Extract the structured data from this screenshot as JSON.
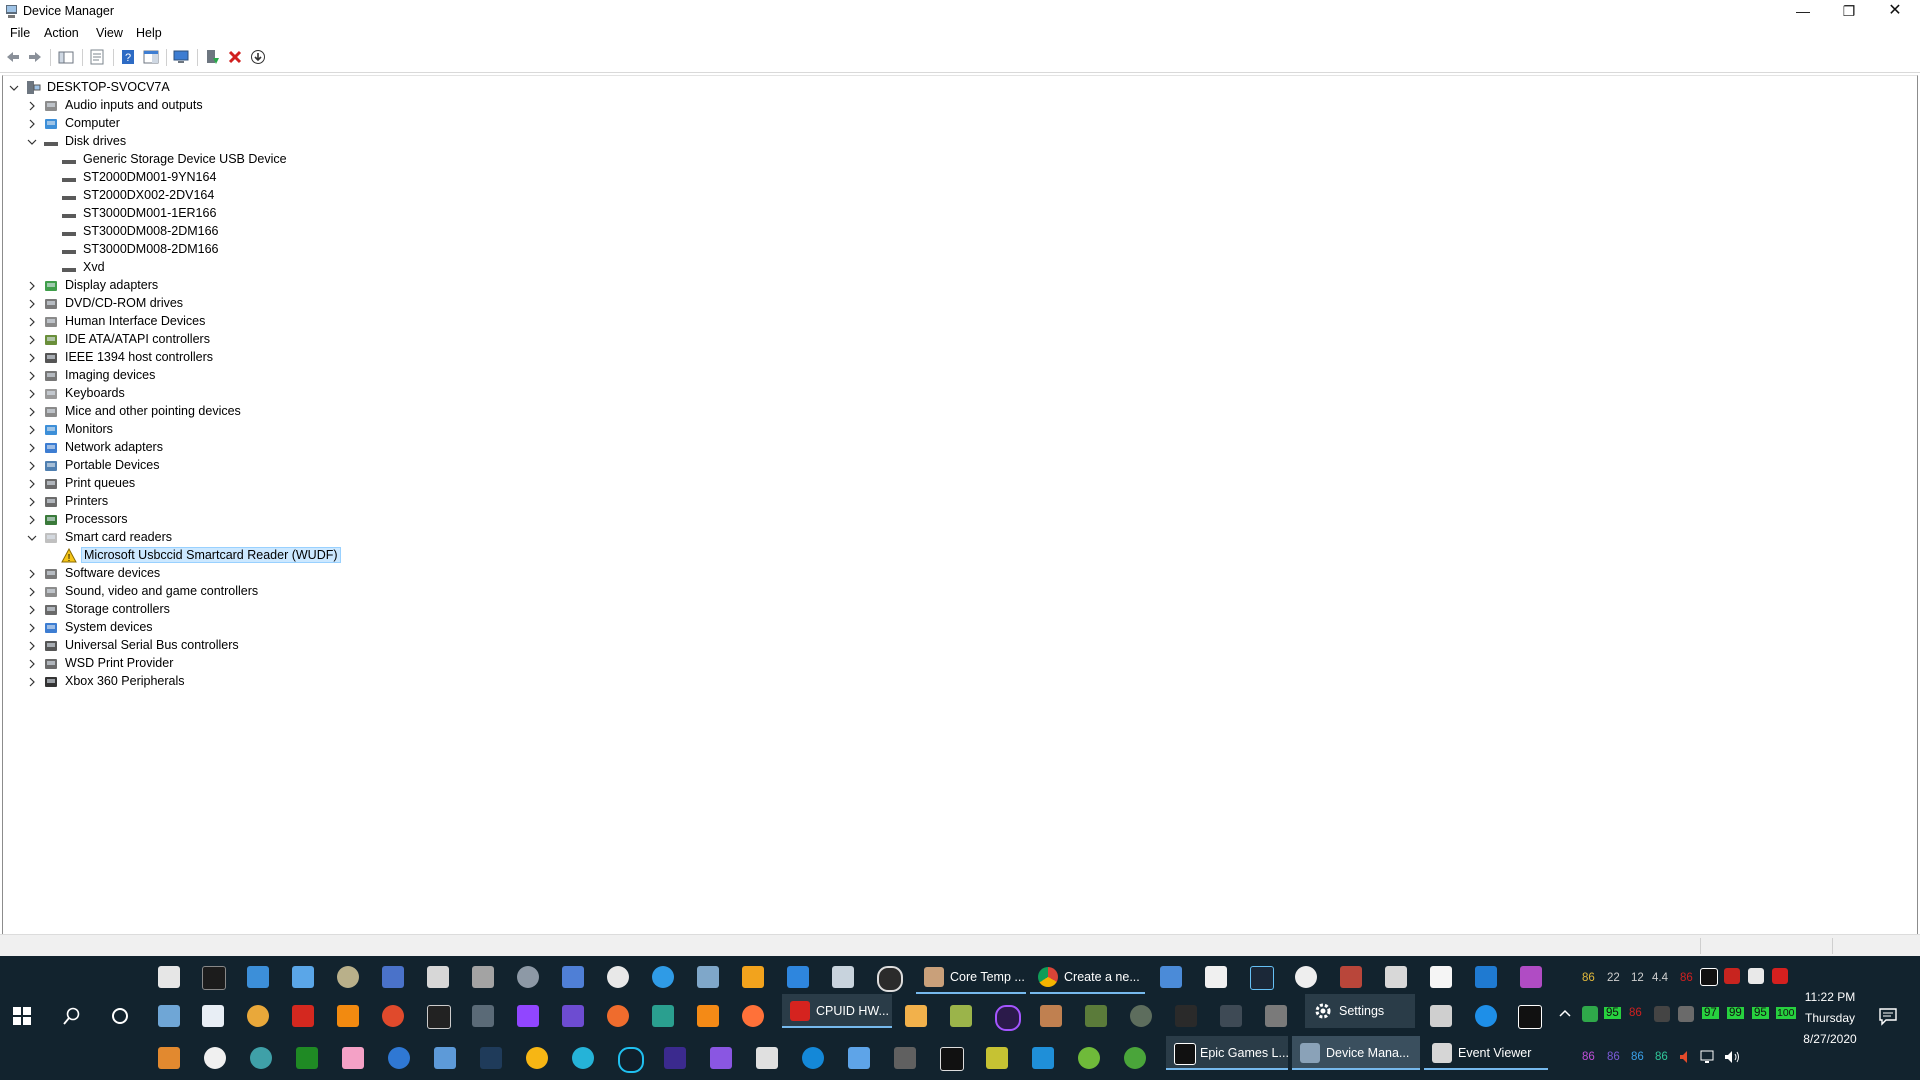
{
  "window": {
    "title": "Device Manager",
    "controls": {
      "minimize": "—",
      "restore": "❐",
      "close": "✕"
    }
  },
  "menu": [
    "File",
    "Action",
    "View",
    "Help"
  ],
  "tree": {
    "root": "DESKTOP-SVOCV7A",
    "rows": [
      {
        "label": "Audio inputs and outputs",
        "expanded": false,
        "icon": "speaker-icon"
      },
      {
        "label": "Computer",
        "expanded": false,
        "icon": "monitor-icon"
      },
      {
        "label": "Disk drives",
        "expanded": true,
        "icon": "disk-drive-icon",
        "children": [
          "Generic Storage Device USB Device",
          "ST2000DM001-9YN164",
          "ST2000DX002-2DV164",
          "ST3000DM001-1ER166",
          "ST3000DM008-2DM166",
          "ST3000DM008-2DM166",
          "Xvd"
        ]
      },
      {
        "label": "Display adapters",
        "expanded": false,
        "icon": "display-adapter-icon"
      },
      {
        "label": "DVD/CD-ROM drives",
        "expanded": false,
        "icon": "dvd-drive-icon"
      },
      {
        "label": "Human Interface Devices",
        "expanded": false,
        "icon": "hid-icon"
      },
      {
        "label": "IDE ATA/ATAPI controllers",
        "expanded": false,
        "icon": "ide-controller-icon"
      },
      {
        "label": "IEEE 1394 host controllers",
        "expanded": false,
        "icon": "firewire-icon"
      },
      {
        "label": "Imaging devices",
        "expanded": false,
        "icon": "camera-icon"
      },
      {
        "label": "Keyboards",
        "expanded": false,
        "icon": "keyboard-icon"
      },
      {
        "label": "Mice and other pointing devices",
        "expanded": false,
        "icon": "mouse-icon"
      },
      {
        "label": "Monitors",
        "expanded": false,
        "icon": "monitor-icon"
      },
      {
        "label": "Network adapters",
        "expanded": false,
        "icon": "network-adapter-icon"
      },
      {
        "label": "Portable Devices",
        "expanded": false,
        "icon": "portable-device-icon"
      },
      {
        "label": "Print queues",
        "expanded": false,
        "icon": "printer-icon"
      },
      {
        "label": "Printers",
        "expanded": false,
        "icon": "printer-icon"
      },
      {
        "label": "Processors",
        "expanded": false,
        "icon": "processor-icon"
      },
      {
        "label": "Smart card readers",
        "expanded": true,
        "icon": "smart-card-reader-icon",
        "children": [
          "Microsoft Usbccid Smartcard Reader (WUDF)"
        ]
      },
      {
        "label": "Software devices",
        "expanded": false,
        "icon": "software-device-icon"
      },
      {
        "label": "Sound, video and game controllers",
        "expanded": false,
        "icon": "speaker-icon"
      },
      {
        "label": "Storage controllers",
        "expanded": false,
        "icon": "storage-controller-icon"
      },
      {
        "label": "System devices",
        "expanded": false,
        "icon": "system-device-icon"
      },
      {
        "label": "Universal Serial Bus controllers",
        "expanded": false,
        "icon": "usb-icon"
      },
      {
        "label": "WSD Print Provider",
        "expanded": false,
        "icon": "printer-icon"
      },
      {
        "label": "Xbox 360 Peripherals",
        "expanded": false,
        "icon": "gamepad-icon"
      }
    ],
    "selected": "Microsoft Usbccid Smartcard Reader (WUDF)"
  },
  "taskbar": {
    "buttons": {
      "core_temp": "Core Temp ...",
      "create_new": "Create a ne...",
      "cpuid": "CPUID HW...",
      "settings": "Settings",
      "epic": "Epic Games L...",
      "device_manager": "Device Mana...",
      "event_viewer": "Event Viewer"
    },
    "tray_row1": [
      "86",
      "22",
      "12",
      "4.4"
    ],
    "tray_row1_extra": "86",
    "tray_row2": [
      "95",
      "86",
      "97",
      "99",
      "95",
      "100"
    ],
    "tray_row3": [
      "86",
      "86",
      "86",
      "86"
    ],
    "clock": {
      "time": "11:22 PM",
      "day": "Thursday",
      "date": "8/27/2020"
    },
    "colors": {
      "bg": "#12232e",
      "accent": "#76b9ed"
    }
  }
}
